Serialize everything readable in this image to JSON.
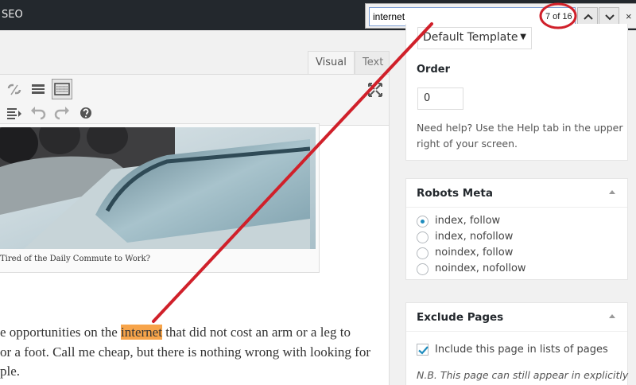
{
  "admin_bar": {
    "label": "SEO"
  },
  "find_bar": {
    "query": "internet",
    "match_count": "7 of 16",
    "close_glyph": "×"
  },
  "editor": {
    "tabs": [
      "Visual",
      "Text"
    ],
    "caption": "Tired of the Daily Commute to Work?",
    "paragraph": {
      "line1_before": "e opportunities on the ",
      "line1_match": "internet",
      "line1_after": " that did not cost an arm or a leg to",
      "line2": "or a foot. Call me cheap, but there is nothing wrong with looking for",
      "line3": "ple."
    },
    "toolbar_icons": [
      "unlink-icon",
      "insert-more-icon",
      "kitchen-sink-icon",
      "indent-icon",
      "undo-icon",
      "redo-icon",
      "help-icon",
      "fullscreen-icon"
    ]
  },
  "page_attributes": {
    "template": "Default Template",
    "order_label": "Order",
    "order_value": "0",
    "help_text": "Need help? Use the Help tab in the upper right of your screen."
  },
  "robots_meta": {
    "title": "Robots Meta",
    "options": [
      {
        "label": "index, follow",
        "checked": true
      },
      {
        "label": "index, nofollow",
        "checked": false
      },
      {
        "label": "noindex, follow",
        "checked": false
      },
      {
        "label": "noindex, nofollow",
        "checked": false
      }
    ]
  },
  "exclude_pages": {
    "title": "Exclude Pages",
    "checkbox_label": "Include this page in lists of pages",
    "checked": true,
    "note": "N.B. This page can still appear in explicitly"
  },
  "colors": {
    "admin_bar": "#23282d",
    "highlight": "#f7a44a",
    "annotation_red": "#d0202a",
    "radio_accent": "#1e8cbe"
  }
}
